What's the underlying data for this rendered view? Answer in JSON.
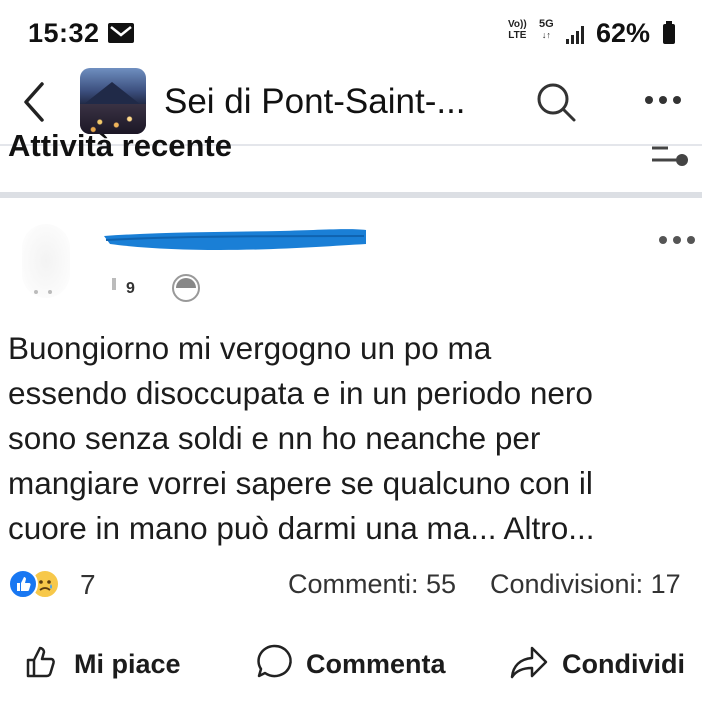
{
  "status_bar": {
    "time": "15:32",
    "network_top": "Vo))",
    "network_bottom": "LTE",
    "network_5g": "5G",
    "battery": "62%",
    "icons": [
      "mail-icon",
      "signal-icon",
      "battery-icon"
    ]
  },
  "header": {
    "title": "Sei di Pont-Saint-...",
    "icons": [
      "back-icon",
      "search-icon",
      "more-icon"
    ]
  },
  "section": {
    "title": "Attività recente"
  },
  "post": {
    "meta_text": "9",
    "text": "Buongiorno mi vergogno  un po ma\nessendo disoccupata  e in un periodo  nero\nsono senza soldi e nn ho neanche  per\nmangiare  vorrei sapere se qualcuno  con il\ncuore in mano può darmi  una ma... Altro...",
    "reaction_count": "7",
    "comments": "Commenti: 55",
    "shares": "Condivisioni: 17",
    "scribble_color": "#1a7fd6"
  },
  "actions": {
    "like": "Mi piace",
    "comment": "Commenta",
    "share": "Condividi"
  },
  "colors": {
    "like_blue": "#1877f2",
    "sad_yellow": "#f7c84a"
  }
}
